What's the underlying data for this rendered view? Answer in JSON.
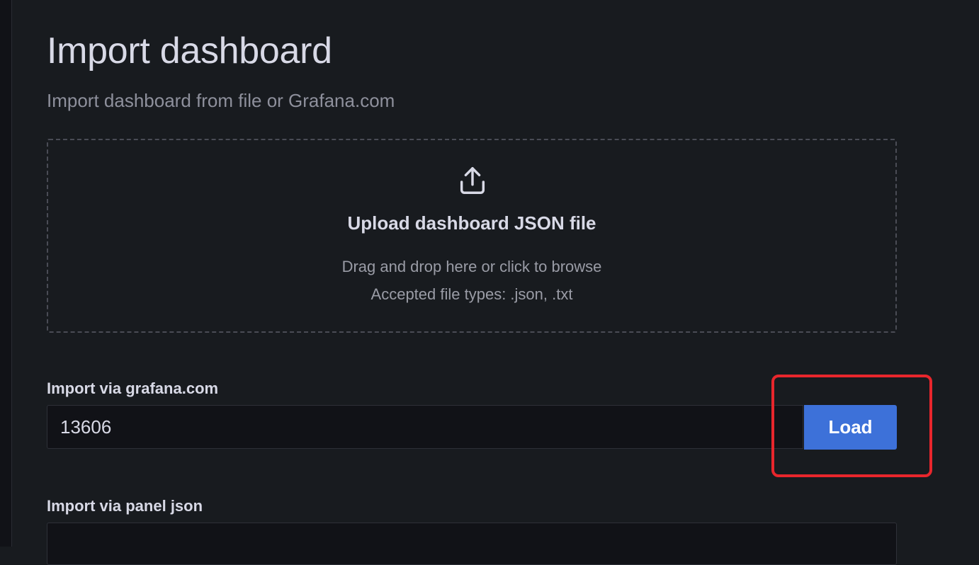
{
  "page": {
    "title": "Import dashboard",
    "subtitle": "Import dashboard from file or Grafana.com"
  },
  "upload": {
    "icon": "upload-icon",
    "title": "Upload dashboard JSON file",
    "hint": "Drag and drop here or click to browse",
    "accepted": "Accepted file types: .json, .txt"
  },
  "grafana_com": {
    "label": "Import via grafana.com",
    "value": "13606",
    "load_label": "Load"
  },
  "panel_json": {
    "label": "Import via panel json",
    "value": ""
  },
  "colors": {
    "background": "#181b1f",
    "primary_button": "#3d71d9",
    "highlight": "#e8262c"
  }
}
